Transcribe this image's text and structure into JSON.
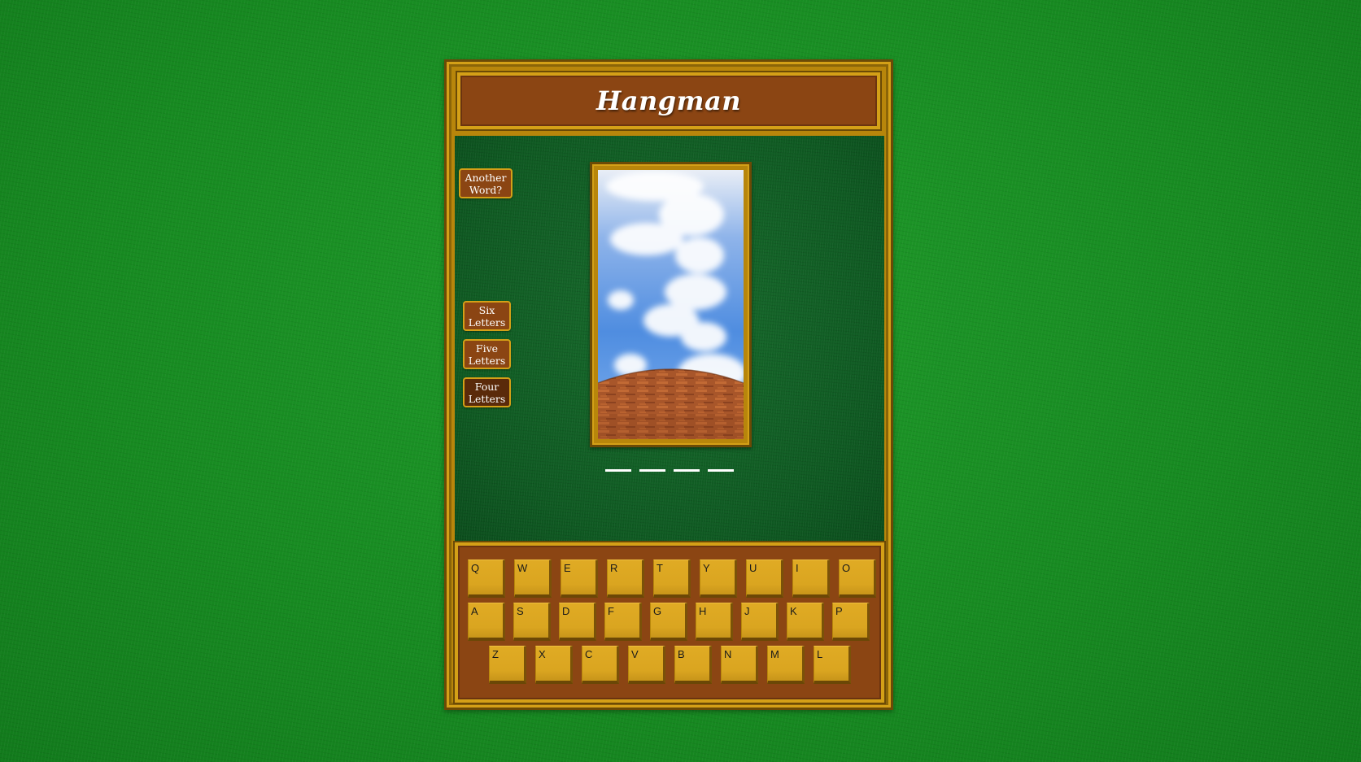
{
  "title": "Hangman",
  "buttons": {
    "another_word": "Another\nWord?",
    "six_letters": "Six\nLetters",
    "five_letters": "Five\nLetters",
    "four_letters": "Four\nLetters"
  },
  "selected_mode": "Four Letters",
  "word_length": 4,
  "keyboard": {
    "row1": [
      "Q",
      "W",
      "E",
      "R",
      "T",
      "Y",
      "U",
      "I",
      "O"
    ],
    "row2": [
      "A",
      "S",
      "D",
      "F",
      "G",
      "H",
      "J",
      "K",
      "P"
    ],
    "row3": [
      "Z",
      "X",
      "C",
      "V",
      "B",
      "N",
      "M",
      "L"
    ]
  },
  "colors": {
    "background_green": "#1a8a24",
    "felt_green": "#0f5a22",
    "frame_gold": "#b8860b",
    "panel_brown": "#8b4513",
    "key_gold": "#daa520"
  }
}
